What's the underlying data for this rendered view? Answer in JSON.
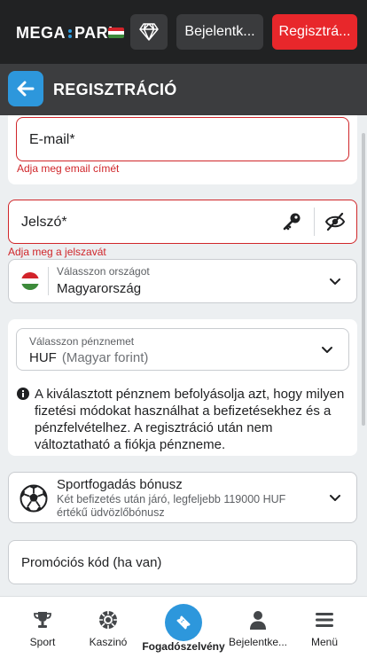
{
  "header": {
    "logo_left": "MEGA",
    "logo_right": "PARI",
    "login_label": "Bejelentk...",
    "register_label": "Regisztrá..."
  },
  "titlebar": {
    "title": "REGISZTRÁCIÓ"
  },
  "form": {
    "email": {
      "label": "E-mail*",
      "error": "Adja meg email címét"
    },
    "password": {
      "label": "Jelszó*",
      "error": "Adja meg a jelszavát"
    },
    "country": {
      "label": "Válasszon országot",
      "value": "Magyarország"
    },
    "currency": {
      "label": "Válasszon pénznemet",
      "code": "HUF",
      "name": "(Magyar forint)",
      "info": "A kiválasztott pénznem befolyásolja azt, hogy milyen fizetési módokat használhat a befizetésekhez és a pénzfelvételhez. A regisztráció után nem változtatható a fiókja pénzneme."
    },
    "bonus": {
      "title": "Sportfogadás bónusz",
      "description": "Két befizetés után járó, legfeljebb 119000 HUF értékű üdvözlőbónusz"
    },
    "promo": {
      "placeholder": "Promóciós kód (ha van)"
    }
  },
  "bottom_nav": {
    "items": [
      {
        "label": "Sport"
      },
      {
        "label": "Kaszinó"
      },
      {
        "label": "Fogadószelvény"
      },
      {
        "label": "Bejelentke..."
      },
      {
        "label": "Menü"
      }
    ]
  },
  "colors": {
    "accent": "#2d97dc",
    "register": "#e8272b",
    "error": "#d0262a",
    "header_bg": "#212223",
    "titlebar_bg": "#3c3d3f"
  }
}
